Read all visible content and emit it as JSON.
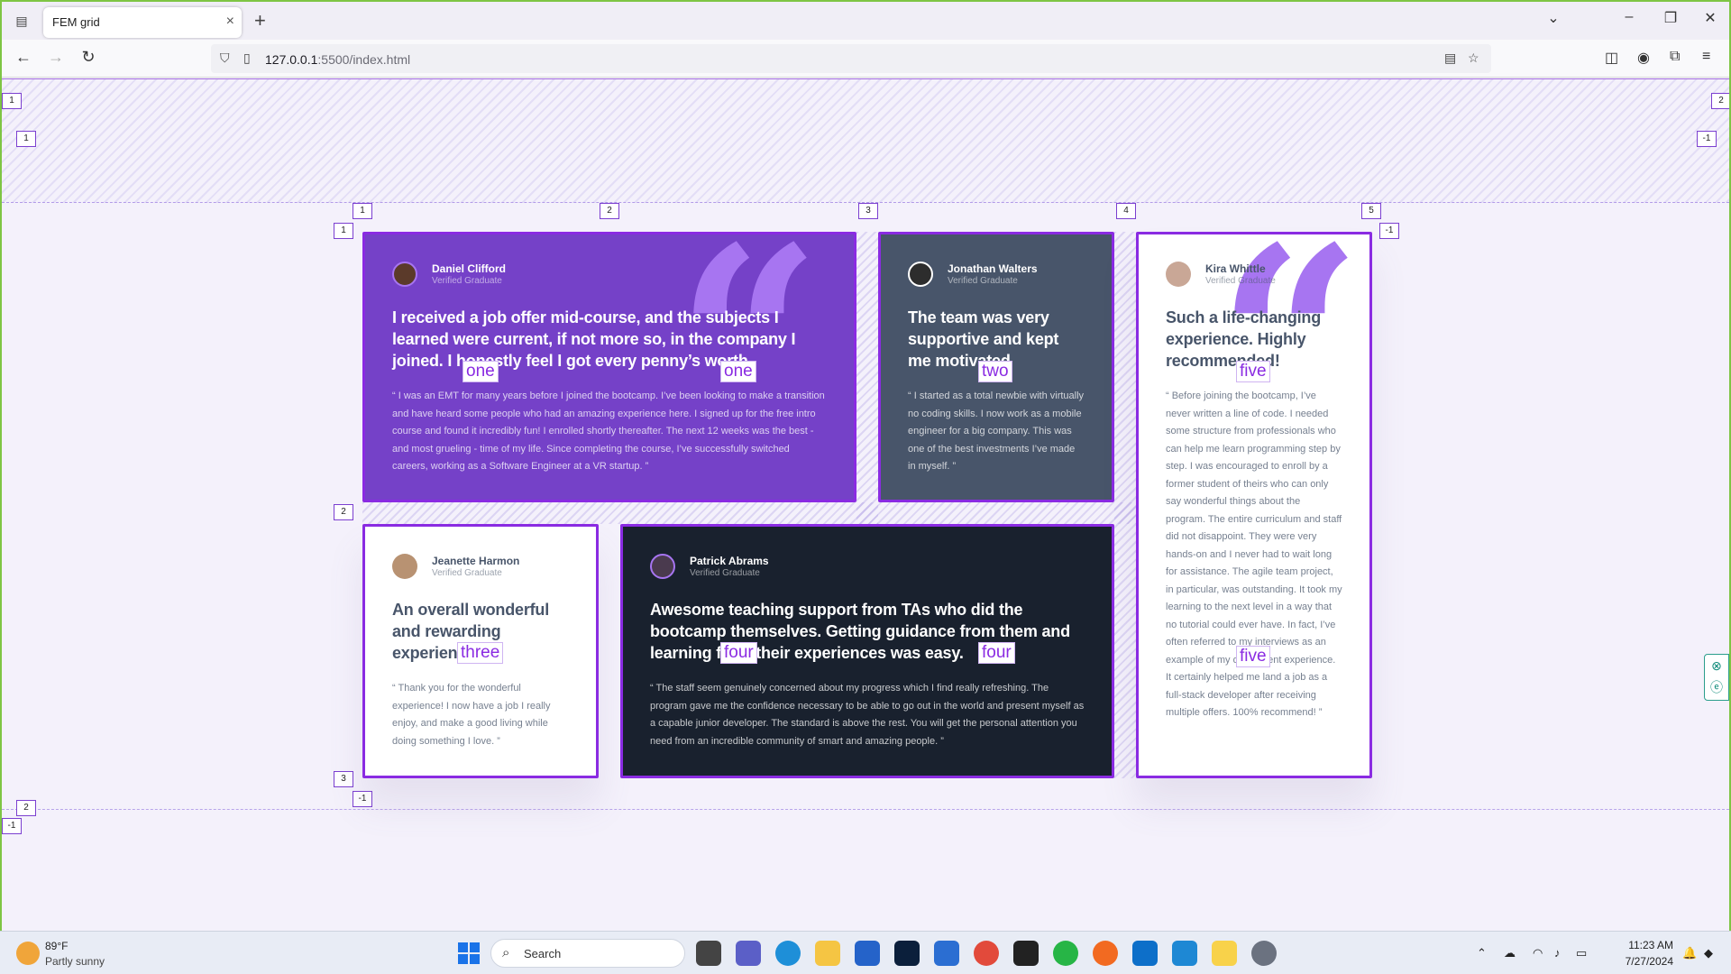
{
  "browser": {
    "tab_title": "FEM grid",
    "url_host": "127.0.0.1",
    "url_rest": ":5500/index.html"
  },
  "testimonials": [
    {
      "name": "Daniel Clifford",
      "role": "Verified Graduate",
      "headline": "I received a job offer mid-course, and the subjects I learned were current, if not more so, in the company I joined. I honestly feel I got every penny’s worth.",
      "body": "“ I was an EMT for many years before I joined the bootcamp. I’ve been looking to make a transition and have heard some people who had an amazing experience here. I signed up for the free intro course and found it incredibly fun! I enrolled shortly thereafter. The next 12 weeks was the best - and most grueling - time of my life. Since completing the course, I’ve successfully switched careers, working as a Software Engineer at a VR startup. ”",
      "area": "one"
    },
    {
      "name": "Jonathan Walters",
      "role": "Verified Graduate",
      "headline": "The team was very supportive and kept me motivated",
      "body": "“ I started as a total newbie with virtually no coding skills. I now work as a mobile engineer for a big company. This was one of the best investments I’ve made in myself. ”",
      "area": "two"
    },
    {
      "name": "Jeanette Harmon",
      "role": "Verified Graduate",
      "headline": "An overall wonderful and rewarding experience",
      "body": "“ Thank you for the wonderful experience! I now have a job I really enjoy, and make a good living while doing something I love. ”",
      "area": "three"
    },
    {
      "name": "Patrick Abrams",
      "role": "Verified Graduate",
      "headline": "Awesome teaching support from TAs who did the bootcamp themselves. Getting guidance from them and learning from their experiences was easy.",
      "body": "“ The staff seem genuinely concerned about my progress which I find really refreshing. The program gave me the confidence necessary to be able to go out in the world and present myself as a capable junior developer. The standard is above the rest. You will get the personal attention you need from an incredible community of smart and amazing people. ”",
      "area": "four"
    },
    {
      "name": "Kira Whittle",
      "role": "Verified Graduate",
      "headline": "Such a life-changing experience. Highly recommended!",
      "body": "“ Before joining the bootcamp, I’ve never written a line of code. I needed some structure from professionals who can help me learn programming step by step. I was encouraged to enroll by a former student of theirs who can only say wonderful things about the program. The entire curriculum and staff did not disappoint. They were very hands-on and I never had to wait long for assistance. The agile team project, in particular, was outstanding. It took my learning to the next level in a way that no tutorial could ever have. In fact, I’ve often referred to my interviews as an example of my developent experience. It certainly helped me land a job as a full-stack developer after receiving multiple offers. 100% recommend! ”",
      "area": "five"
    }
  ],
  "grid_lines": {
    "col": [
      "1",
      "2",
      "3",
      "4",
      "5"
    ],
    "row": [
      "1",
      "2",
      "3"
    ],
    "neg": "-1",
    "outer_top": "1",
    "outer_right": "2",
    "outer_bottom": "2"
  },
  "taskbar": {
    "temp": "89°F",
    "weather": "Partly sunny",
    "search": "Search",
    "time": "11:23 AM",
    "date": "7/27/2024"
  },
  "colors": {
    "purple": "#7541c8",
    "slate": "#48556a",
    "dark": "#19212e",
    "quote": "#a775f1",
    "devtools_grid": "#8a2be2"
  }
}
